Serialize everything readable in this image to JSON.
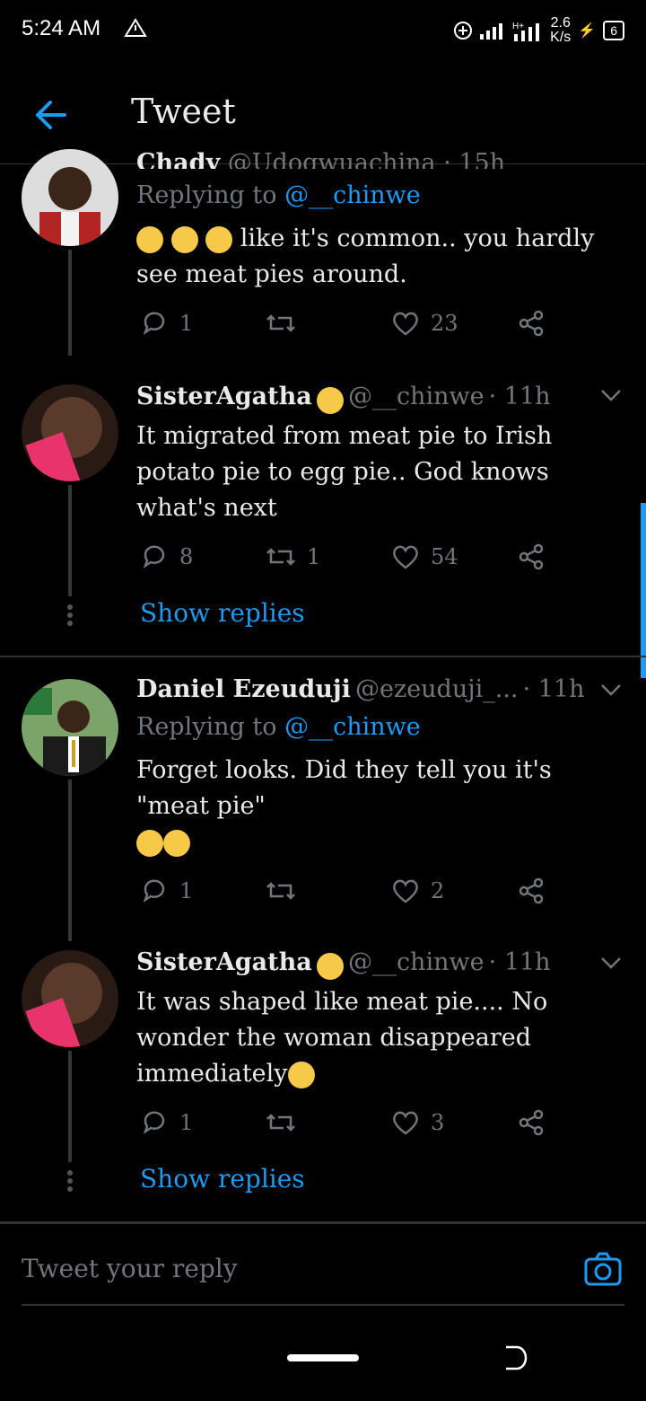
{
  "status": {
    "time": "5:24 AM",
    "speed_top": "2.6",
    "speed_unit": "K/s",
    "battery": "6"
  },
  "header": {
    "title": "Tweet"
  },
  "tweets": [
    {
      "name_partial": "Chady",
      "handle_partial": "@Udogwuachina · 15h",
      "replying_label": "Replying to",
      "replying_handle": "@__chinwe",
      "text": "like it's common.. you hardly see meat pies around.",
      "replies": "1",
      "retweets": "",
      "likes": "23"
    },
    {
      "name": "SisterAgatha",
      "handle": "@__chinwe",
      "time": "· 11h",
      "text": "It migrated from meat pie to Irish potato pie to egg pie.. God knows what's next",
      "replies": "8",
      "retweets": "1",
      "likes": "54",
      "show_replies": "Show replies"
    },
    {
      "name": "Daniel Ezeuduji",
      "handle": "@ezeuduji_...",
      "time": "· 11h",
      "replying_label": "Replying to",
      "replying_handle": "@__chinwe",
      "text_line1": "Forget looks. Did they tell you it's",
      "text_line2": "\"meat pie\"",
      "replies": "1",
      "retweets": "",
      "likes": "2"
    },
    {
      "name": "SisterAgatha",
      "handle": "@__chinwe",
      "time": "· 11h",
      "text": "It was shaped like meat pie.... No wonder the woman disappeared immediately",
      "replies": "1",
      "retweets": "",
      "likes": "3",
      "show_replies": "Show replies"
    }
  ],
  "composer": {
    "placeholder": "Tweet your reply"
  },
  "colors": {
    "accent": "#1d9bf0",
    "muted": "#71767b",
    "background": "#000000"
  }
}
